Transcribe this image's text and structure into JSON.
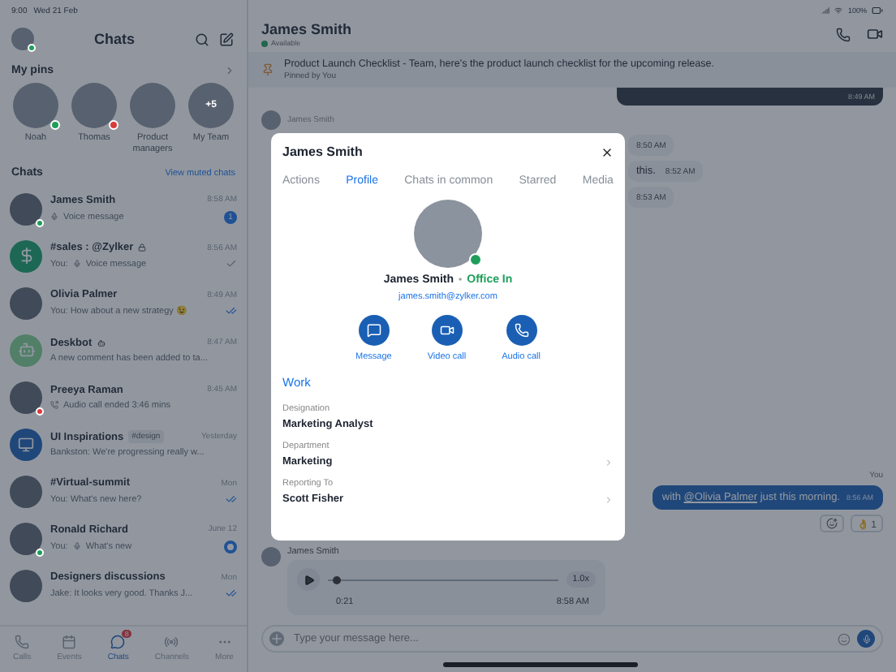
{
  "status_bar": {
    "time": "9:00",
    "date": "Wed 21 Feb",
    "battery": "100%"
  },
  "sidebar": {
    "title": "Chats",
    "pins_title": "My pins",
    "pins": [
      {
        "name": "Noah",
        "color": "#1e9e5a"
      },
      {
        "name": "Thomas",
        "color": "#d93b3b"
      },
      {
        "name": "Product managers"
      },
      {
        "name": "My Team",
        "more": "+5"
      }
    ],
    "chats_title": "Chats",
    "muted_link": "View muted chats",
    "chats": [
      {
        "kind": "photo",
        "name": "James Smith",
        "preview": "Voice message",
        "voice": true,
        "time": "8:58 AM",
        "color": "#1e9e5a",
        "unread": "1"
      },
      {
        "kind": "dollar",
        "name": "#sales : @Zylker",
        "locked": true,
        "preview": "You:",
        "voice": true,
        "voice_text": "Voice message",
        "time": "8:56 AM",
        "delivered": true
      },
      {
        "kind": "photo",
        "name": "Olivia Palmer",
        "preview": "You: How about a new strategy 😉",
        "time": "8:49 AM",
        "read": true
      },
      {
        "kind": "bot",
        "name": "Deskbot",
        "bot": true,
        "preview": "A new comment has been added to ta...",
        "time": "8:47 AM"
      },
      {
        "kind": "photo",
        "name": "Preeya Raman",
        "preview": "Audio call ended 3:46 mins",
        "call": true,
        "time": "8:45 AM",
        "color": "#d93b3b"
      },
      {
        "kind": "channel",
        "name": "UI Inspirations",
        "tag": "#design",
        "preview": "Bankston: We're progressing really w...",
        "time": "Yesterday"
      },
      {
        "kind": "photo",
        "name": "#Virtual-summit",
        "preview": "You: What's new here?",
        "time": "Mon",
        "read": true
      },
      {
        "kind": "photo",
        "name": "Ronald Richard",
        "preview": "You:",
        "voice": true,
        "voice_text": "What's new",
        "time": "June 12",
        "mentioned": true,
        "color": "#1e9e5a"
      },
      {
        "kind": "photo",
        "name": "Designers discussions",
        "preview": "Jake: It looks very good. Thanks J...",
        "time": "Mon",
        "read": true
      }
    ],
    "tabs": [
      {
        "label": "Calls",
        "selected": false
      },
      {
        "label": "Events",
        "selected": false
      },
      {
        "label": "Chats",
        "selected": true,
        "badge": "8"
      },
      {
        "label": "Channels",
        "selected": false
      },
      {
        "label": "More",
        "selected": false
      }
    ]
  },
  "conversation": {
    "name": "James Smith",
    "presence": "Available",
    "pinned": {
      "text": "Product Launch Checklist - Team, here's the product launch checklist for the upcoming release.",
      "by": "Pinned by You"
    },
    "image_time": "8:49 AM",
    "sender": "James Smith",
    "fragments": [
      {
        "time": "8:50 AM"
      },
      {
        "text": "this.",
        "time": "8:52 AM"
      },
      {
        "time": "8:53 AM"
      }
    ],
    "you_label": "You",
    "outgoing": {
      "before": "with ",
      "mention": "@Olivia Palmer",
      "after": " just this morning.",
      "time": "8:56 AM"
    },
    "reaction_emoji": "👌",
    "reaction_count": "1",
    "voice": {
      "sender": "James Smith",
      "duration": "0:21",
      "time": "8:58 AM",
      "speed": "1.0x",
      "level": 0.02
    },
    "composer_placeholder": "Type your message here..."
  },
  "profile": {
    "title": "James Smith",
    "tabs": [
      {
        "label": "Actions",
        "selected": false
      },
      {
        "label": "Profile",
        "selected": true
      },
      {
        "label": "Chats in common",
        "selected": false
      },
      {
        "label": "Starred",
        "selected": false
      },
      {
        "label": "Media",
        "selected": false
      }
    ],
    "name": "James Smith",
    "separator": "•",
    "status": "Office In",
    "email": "james.smith@zylker.com",
    "actions": [
      {
        "label": "Message"
      },
      {
        "label": "Video call"
      },
      {
        "label": "Audio call"
      }
    ],
    "section": "Work",
    "fields": [
      {
        "label": "Designation",
        "value": "Marketing Analyst",
        "link": false
      },
      {
        "label": "Department",
        "value": "Marketing",
        "link": true
      },
      {
        "label": "Reporting To",
        "value": "Scott Fisher",
        "link": true
      }
    ]
  }
}
